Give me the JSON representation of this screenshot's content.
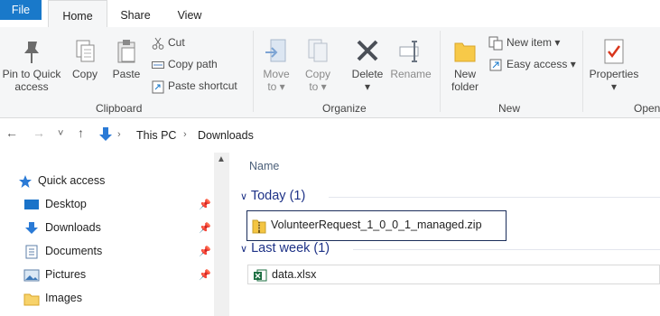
{
  "tabs": {
    "file": "File",
    "home": "Home",
    "share": "Share",
    "view": "View"
  },
  "clipboard": {
    "pin": "Pin to Quick access",
    "pin_l1": "Pin to Quick",
    "pin_l2": "access",
    "copy": "Copy",
    "paste": "Paste",
    "cut": "Cut",
    "copy_path": "Copy path",
    "paste_shortcut": "Paste shortcut",
    "group": "Clipboard"
  },
  "organize": {
    "move_l1": "Move",
    "move_l2": "to",
    "copy_l1": "Copy",
    "copy_l2": "to",
    "delete": "Delete",
    "rename": "Rename",
    "group": "Organize"
  },
  "new": {
    "folder_l1": "New",
    "folder_l2": "folder",
    "new_item": "New item",
    "easy_access": "Easy access",
    "group": "New"
  },
  "open": {
    "properties": "Properties",
    "group": "Open"
  },
  "address": {
    "crumbs": [
      "This PC",
      "Downloads"
    ]
  },
  "nav": {
    "quick_access": "Quick access",
    "items": [
      "Desktop",
      "Downloads",
      "Documents",
      "Pictures",
      "Images"
    ]
  },
  "content": {
    "column_name": "Name",
    "groups": [
      {
        "title": "Today (1)",
        "files": [
          "VolunteerRequest_1_0_0_1_managed.zip"
        ]
      },
      {
        "title": "Last week (1)",
        "files": [
          "data.xlsx"
        ]
      }
    ]
  },
  "colors": {
    "accent": "#1979ca",
    "group_header": "#1e3287",
    "selection_border": "#1a2d5a"
  },
  "icons": [
    "pin-icon",
    "copy-icon",
    "paste-icon",
    "cut-icon",
    "copy-path-icon",
    "paste-shortcut-icon",
    "move-to-icon",
    "copy-to-icon",
    "delete-icon",
    "rename-icon",
    "new-folder-icon",
    "new-item-icon",
    "easy-access-icon",
    "properties-icon",
    "star-icon",
    "desktop-icon",
    "download-arrow-icon",
    "document-icon",
    "pictures-icon",
    "folder-icon",
    "zip-icon",
    "excel-icon"
  ]
}
